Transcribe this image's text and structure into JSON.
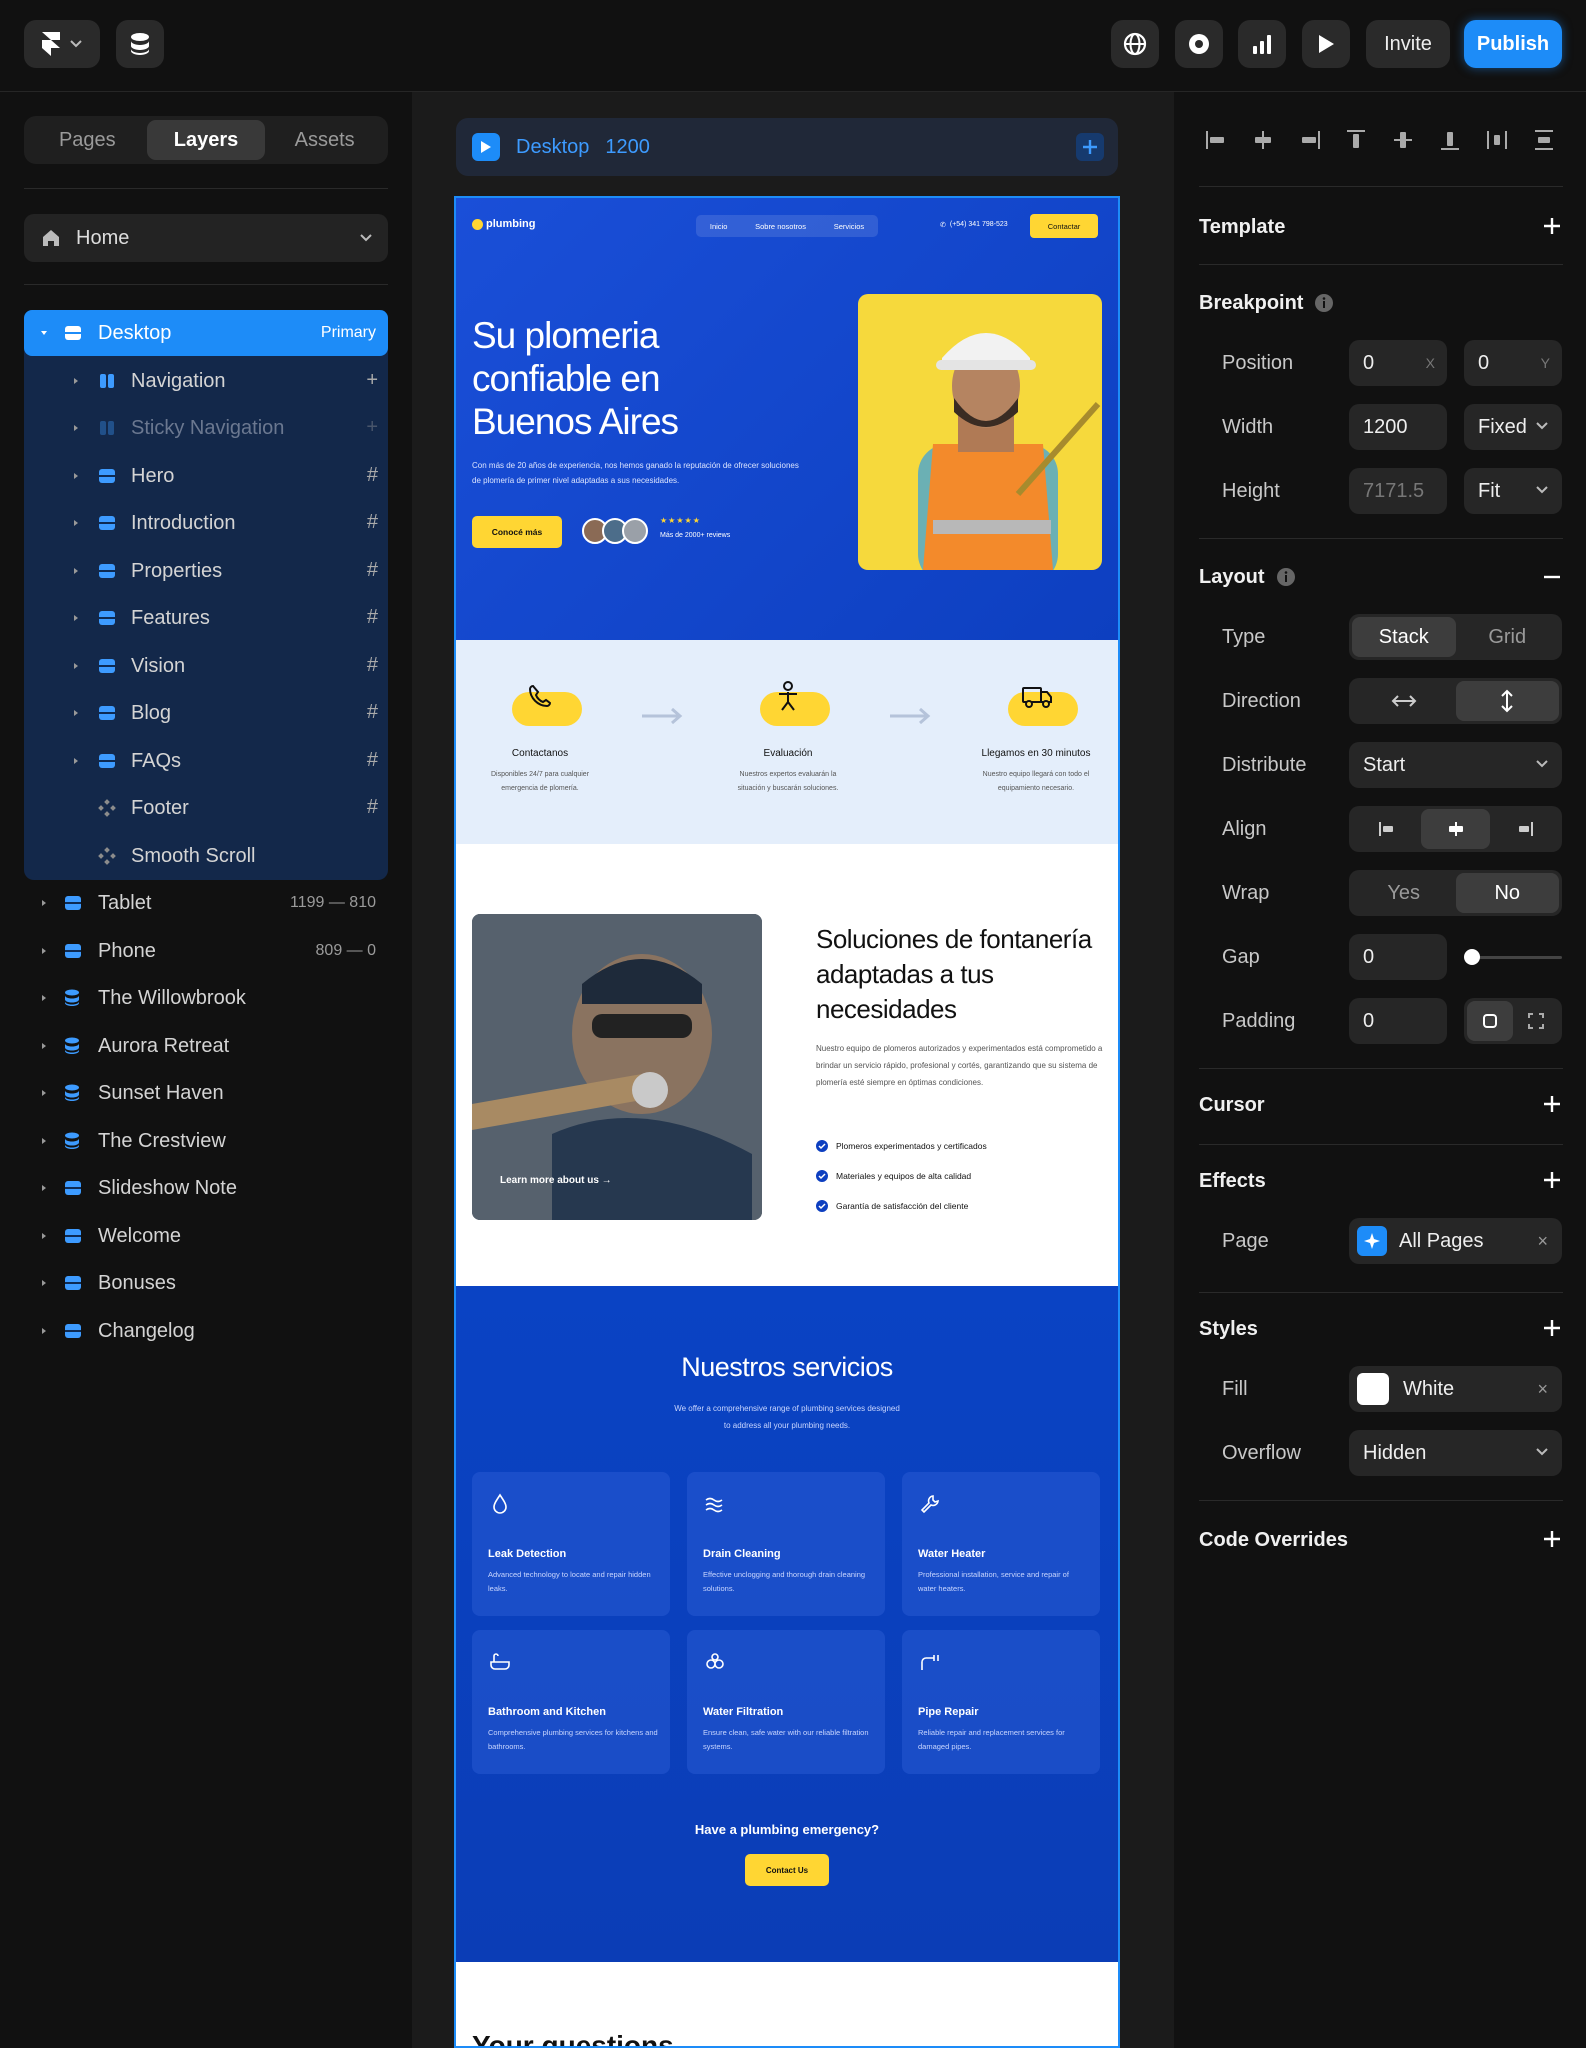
{
  "topbar": {
    "invite_label": "Invite",
    "publish_label": "Publish",
    "accent": "#1d8cf8"
  },
  "left_panel": {
    "tabs": [
      "Pages",
      "Layers",
      "Assets"
    ],
    "active_tab": "Layers",
    "page_selector": "Home",
    "layers": [
      {
        "label": "Desktop",
        "tag": "Primary",
        "icon": "breakpoint-icon"
      },
      {
        "label": "Navigation",
        "action": "+",
        "icon": "stack-icon"
      },
      {
        "label": "Sticky Navigation",
        "action": "+",
        "icon": "stack-icon"
      },
      {
        "label": "Hero",
        "action": "#",
        "icon": "frame-icon"
      },
      {
        "label": "Introduction",
        "action": "#",
        "icon": "frame-icon"
      },
      {
        "label": "Properties",
        "action": "#",
        "icon": "frame-icon"
      },
      {
        "label": "Features",
        "action": "#",
        "icon": "frame-icon"
      },
      {
        "label": "Vision",
        "action": "#",
        "icon": "frame-icon"
      },
      {
        "label": "Blog",
        "action": "#",
        "icon": "frame-icon"
      },
      {
        "label": "FAQs",
        "action": "#",
        "icon": "frame-icon"
      },
      {
        "label": "Footer",
        "action": "#",
        "icon": "component-icon"
      },
      {
        "label": "Smooth Scroll",
        "icon": "component-icon"
      }
    ],
    "pages": [
      {
        "label": "Tablet",
        "tag": "1199 — 810",
        "icon": "breakpoint-icon"
      },
      {
        "label": "Phone",
        "tag": "809 — 0",
        "icon": "breakpoint-icon"
      },
      {
        "label": "The Willowbrook",
        "icon": "database-icon"
      },
      {
        "label": "Aurora Retreat",
        "icon": "database-icon"
      },
      {
        "label": "Sunset Haven",
        "icon": "database-icon"
      },
      {
        "label": "The Crestview",
        "icon": "database-icon"
      },
      {
        "label": "Slideshow Note",
        "icon": "breakpoint-icon"
      },
      {
        "label": "Welcome",
        "icon": "breakpoint-icon"
      },
      {
        "label": "Bonuses",
        "icon": "breakpoint-icon"
      },
      {
        "label": "Changelog",
        "icon": "breakpoint-icon"
      }
    ]
  },
  "canvas": {
    "breakpoint_name": "Desktop",
    "breakpoint_width": "1200"
  },
  "site": {
    "logo": "plumbing",
    "nav": [
      "Inicio",
      "Sobre nosotros",
      "Servicios"
    ],
    "phone": "(+54) 341 798-523",
    "cta": "Contactar",
    "hero_title": "Su plomeria confiable en Buenos Aires",
    "hero_text": "Con más de 20 años de experiencia, nos hemos ganado la reputación de ofrecer soluciones de plomería de primer nivel adaptadas a sus necesidades.",
    "hero_button": "Conocé más",
    "reviews_stars": "★★★★★",
    "reviews_text": "Más de 2000+ reviews",
    "steps": [
      {
        "title": "Contactanos",
        "desc": "Disponibles 24/7 para cualquier emergencia de plomería.",
        "icon": "phone-icon"
      },
      {
        "title": "Evaluación",
        "desc": "Nuestros expertos evaluarán la situación y buscarán soluciones.",
        "icon": "person-icon"
      },
      {
        "title": "Llegamos en 30 minutos",
        "desc": "Nuestro equipo llegará con todo el equipamiento necesario.",
        "icon": "truck-icon"
      }
    ],
    "intro_title": "Soluciones de fontanería adaptadas a tus necesidades",
    "intro_text": "Nuestro equipo de plomeros autorizados y experimentados está comprometido a brindar un servicio rápido, profesional y cortés, garantizando que su sistema de plomería esté siempre en óptimas condiciones.",
    "intro_points": [
      "Plomeros experimentados y certificados",
      "Materiales y equipos de alta calidad",
      "Garantía de satisfacción del cliente"
    ],
    "intro_link": "Learn more about us →",
    "services_title": "Nuestros servicios",
    "services_sub": "We offer a comprehensive range of plumbing services designed to address all your plumbing needs.",
    "services": [
      {
        "title": "Leak Detection",
        "desc": "Advanced technology to locate and repair hidden leaks.",
        "icon": "droplet-icon"
      },
      {
        "title": "Drain Cleaning",
        "desc": "Effective unclogging and thorough drain cleaning solutions.",
        "icon": "waves-icon"
      },
      {
        "title": "Water Heater",
        "desc": "Professional installation, service and repair of water heaters.",
        "icon": "wrench-icon"
      },
      {
        "title": "Bathroom and Kitchen",
        "desc": "Comprehensive plumbing services for kitchens and bathrooms.",
        "icon": "bathtub-icon"
      },
      {
        "title": "Water Filtration",
        "desc": "Ensure clean, safe water with our reliable filtration systems.",
        "icon": "filter-icon"
      },
      {
        "title": "Pipe Repair",
        "desc": "Reliable repair and replacement services for damaged pipes.",
        "icon": "pipe-icon"
      }
    ],
    "emergency_text": "Have a plumbing emergency?",
    "emergency_button": "Contact Us",
    "next_heading": "Your questions"
  },
  "right_panel": {
    "template_label": "Template",
    "breakpoint_label": "Breakpoint",
    "position_label": "Position",
    "position_x": "0",
    "position_y": "0",
    "x_suffix": "X",
    "y_suffix": "Y",
    "width_label": "Width",
    "width_value": "1200",
    "width_mode": "Fixed",
    "height_label": "Height",
    "height_value": "7171.5",
    "height_mode": "Fit",
    "layout_label": "Layout",
    "type_label": "Type",
    "type_options": [
      "Stack",
      "Grid"
    ],
    "type_selected": "Stack",
    "direction_label": "Direction",
    "distribute_label": "Distribute",
    "distribute_value": "Start",
    "align_label": "Align",
    "wrap_label": "Wrap",
    "wrap_options": [
      "Yes",
      "No"
    ],
    "wrap_selected": "No",
    "gap_label": "Gap",
    "gap_value": "0",
    "gap_slider_value": 0,
    "padding_label": "Padding",
    "padding_value": "0",
    "cursor_label": "Cursor",
    "effects_label": "Effects",
    "page_label": "Page",
    "page_value": "All Pages",
    "styles_label": "Styles",
    "fill_label": "Fill",
    "fill_value": "White",
    "fill_color": "#ffffff",
    "overflow_label": "Overflow",
    "overflow_value": "Hidden",
    "code_overrides_label": "Code Overrides"
  }
}
